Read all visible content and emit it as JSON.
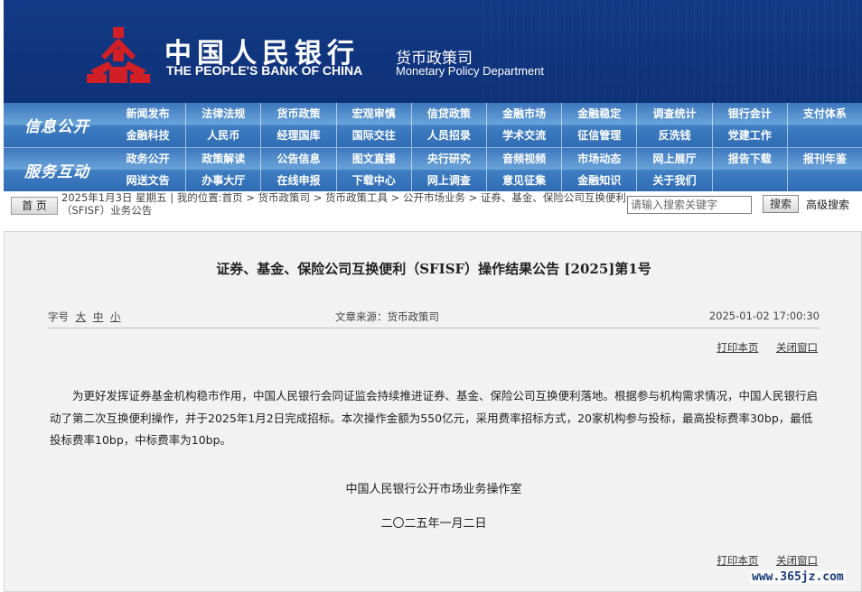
{
  "header": {
    "bank_cn": "中国人民银行",
    "bank_en": "THE PEOPLE'S BANK OF CHINA",
    "dept_cn": "货币政策司",
    "dept_en": "Monetary Policy Department",
    "colors": {
      "header_bg": "#123a86",
      "logo_red": "#d11f25"
    }
  },
  "nav": {
    "sections": [
      {
        "label": "信息公开",
        "items": [
          "新闻发布",
          "法律法规",
          "货币政策",
          "宏观审慎",
          "信贷政策",
          "金融市场",
          "金融稳定",
          "调查统计",
          "银行会计",
          "支付体系",
          "金融科技",
          "人民币",
          "经理国库",
          "国际交往",
          "人员招录",
          "学术交流",
          "征信管理",
          "反洗钱",
          "党建工作",
          ""
        ]
      },
      {
        "label": "服务互动",
        "items": [
          "政务公开",
          "政策解读",
          "公告信息",
          "图文直播",
          "央行研究",
          "音频视频",
          "市场动态",
          "网上展厅",
          "报告下载",
          "报刊年鉴",
          "网送文告",
          "办事大厅",
          "在线申报",
          "下载中心",
          "网上调查",
          "意见征集",
          "金融知识",
          "关于我们",
          "",
          ""
        ]
      }
    ]
  },
  "locbar": {
    "home_label": "首 页",
    "location_text": "2025年1月3日 星期五 | 我的位置:首页 > 货币政策司 > 货币政策工具 > 公开市场业务 > 证券、基金、保险公司互换便利（SFISF）业务公告",
    "search_placeholder": "请输入搜索关键字",
    "search_button": "搜索",
    "advanced_search": "高级搜索"
  },
  "article": {
    "title": "证券、基金、保险公司互换便利（SFISF）操作结果公告 [2025]第1号",
    "font_size_label": "字号",
    "font_sizes": [
      "大",
      "中",
      "小"
    ],
    "source": "文章来源：货币政策司",
    "date": "2025-01-02 17:00:30",
    "print_label": "打印本页",
    "close_label": "关闭窗口",
    "body": "为更好发挥证券基金机构稳市作用，中国人民银行会同证监会持续推进证券、基金、保险公司互换便利落地。根据参与机构需求情况，中国人民银行启动了第二次互换便利操作，并于2025年1月2日完成招标。本次操作金额为550亿元，采用费率招标方式，20家机构参与投标，最高投标费率30bp，最低投标费率10bp，中标费率为10bp。",
    "sign_org": "中国人民银行公开市场业务操作室",
    "sign_date": "二〇二五年一月二日"
  },
  "watermark": "www.365jz.com"
}
